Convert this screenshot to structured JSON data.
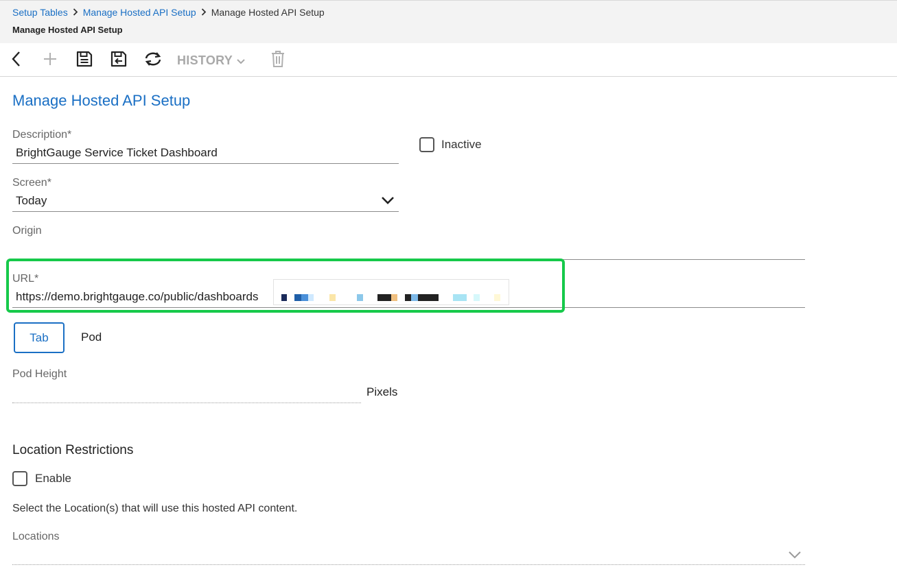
{
  "breadcrumb": {
    "items": [
      "Setup Tables",
      "Manage Hosted API Setup",
      "Manage Hosted API Setup"
    ],
    "separator": "›"
  },
  "page_subtitle": "Manage Hosted API Setup",
  "toolbar": {
    "history_label": "HISTORY"
  },
  "form": {
    "section_title": "Manage Hosted API Setup",
    "description": {
      "label": "Description*",
      "value": "BrightGauge Service Ticket Dashboard"
    },
    "inactive": {
      "label": "Inactive",
      "checked": false
    },
    "screen": {
      "label": "Screen*",
      "value": "Today"
    },
    "origin": {
      "label": "Origin",
      "value": ""
    },
    "url": {
      "label": "URL*",
      "value": "https://demo.brightgauge.co/public/dashboards"
    },
    "display_mode": {
      "tab_label": "Tab",
      "pod_label": "Pod",
      "selected": "Tab"
    },
    "pod_height": {
      "label": "Pod Height",
      "value": "",
      "unit": "Pixels"
    }
  },
  "location_restrictions": {
    "title": "Location Restrictions",
    "enable": {
      "label": "Enable",
      "checked": false
    },
    "note": "Select the Location(s) that will use this hosted API content.",
    "locations_label": "Locations"
  },
  "colors": {
    "accent": "#1a6fc4",
    "highlight": "#16c94a"
  }
}
